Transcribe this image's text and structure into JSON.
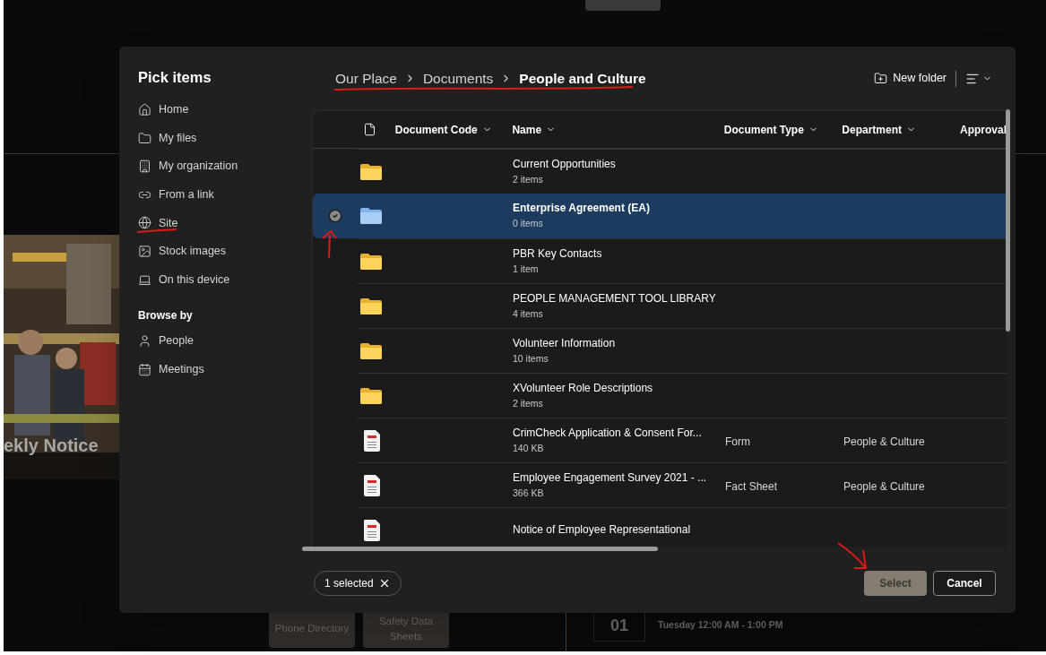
{
  "background": {
    "notice_title": "ekly Notice",
    "tiles": [
      "Phone Directory",
      "Safety Data Sheets"
    ],
    "event": {
      "day": "01",
      "time": "Tuesday 12:00 AM - 1:00 PM"
    }
  },
  "dialog": {
    "title": "Pick items",
    "nav": [
      {
        "label": "Home"
      },
      {
        "label": "My files"
      },
      {
        "label": "My organization"
      },
      {
        "label": "From a link"
      },
      {
        "label": "Site"
      },
      {
        "label": "Stock images"
      },
      {
        "label": "On this device"
      }
    ],
    "browse_heading": "Browse by",
    "browse": [
      {
        "label": "People"
      },
      {
        "label": "Meetings"
      }
    ],
    "breadcrumbs": [
      {
        "label": "Our Place",
        "current": false
      },
      {
        "label": "Documents",
        "current": false
      },
      {
        "label": "People and Culture",
        "current": true
      }
    ],
    "new_folder": "New folder",
    "columns": [
      "Document Code",
      "Name",
      "Document Type",
      "Department",
      "Approval"
    ],
    "rows": [
      {
        "kind": "folder",
        "name": "Current Opportunities",
        "meta": "2 items",
        "selected": false
      },
      {
        "kind": "folder",
        "name": "Enterprise Agreement (EA)",
        "meta": "0 items",
        "selected": true
      },
      {
        "kind": "folder",
        "name": "PBR Key Contacts",
        "meta": "1 item",
        "selected": false
      },
      {
        "kind": "folder",
        "name": "PEOPLE MANAGEMENT TOOL LIBRARY",
        "meta": "4 items",
        "selected": false
      },
      {
        "kind": "folder",
        "name": "Volunteer Information",
        "meta": "10 items",
        "selected": false
      },
      {
        "kind": "folder",
        "name": "XVolunteer Role Descriptions",
        "meta": "2 items",
        "selected": false
      },
      {
        "kind": "pdf",
        "name": "CrimCheck Application & Consent For...",
        "meta": "140 KB",
        "type": "Form",
        "department": "People & Culture",
        "selected": false
      },
      {
        "kind": "pdf",
        "name": "Employee Engagement Survey 2021 - ...",
        "meta": "366 KB",
        "type": "Fact Sheet",
        "department": "People & Culture",
        "selected": false
      },
      {
        "kind": "pdf",
        "name": "Notice of Employee Representational",
        "selected": false
      }
    ],
    "selection_chip": "1 selected",
    "buttons": [
      {
        "kind": "primary",
        "label": "Select",
        "disabled": true
      },
      {
        "kind": "secondary",
        "label": "Cancel",
        "disabled": false
      }
    ]
  }
}
